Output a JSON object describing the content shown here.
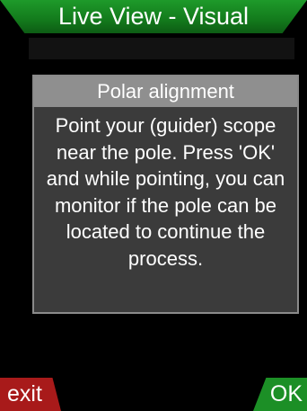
{
  "header": {
    "title": "Live View - Visual"
  },
  "dialog": {
    "title": "Polar alignment",
    "message": "Point your (guider) scope near the pole. Press 'OK' and while pointing, you can monitor if the pole can be located to continue the process."
  },
  "softkeys": {
    "left_label": "exit",
    "right_label": "OK"
  },
  "colors": {
    "title_bar": "#137a1c",
    "dialog_header": "#8f8f8f",
    "dialog_body": "#3b3b3b",
    "exit_key": "#a81a1a",
    "ok_key": "#1c8f26"
  }
}
